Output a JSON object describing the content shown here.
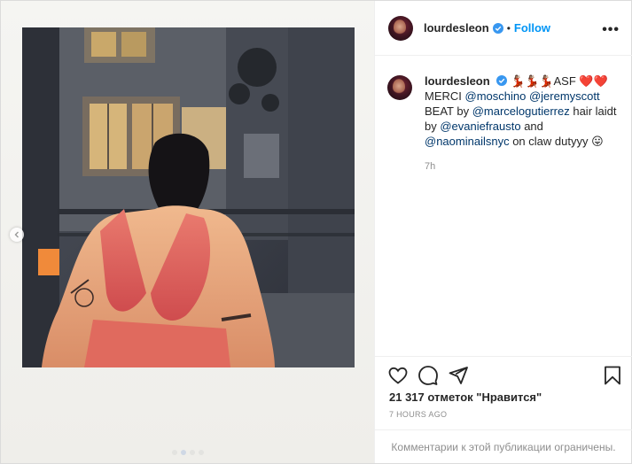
{
  "post": {
    "username": "lourdesleon",
    "separator": "•",
    "follow_label": "Follow",
    "more_label": "•••",
    "caption": {
      "emoji_line": "💃🏽💃🏽💃🏽ASF ❤️❤️",
      "p1": "MERCI ",
      "m1": "@moschino",
      "p2": " ",
      "m2": "@jeremyscott",
      "p3": " BEAT by ",
      "m3": "@marcelogutierrez",
      "p4": " hair laidt by ",
      "m4": "@evaniefrausto",
      "p5": " and ",
      "m5": "@naominailsnyc",
      "p6": " on claw dutyyy 😛"
    },
    "time_ago": "7h",
    "likes_text": "21 317 отметок \"Нравится\"",
    "date_text": "7 HOURS AGO",
    "comments_limited_text": "Комментарии к этой публикации ограничены."
  },
  "icons": {
    "verified": "verified-badge-icon",
    "heart": "heart-outline-icon",
    "comment": "comment-bubble-icon",
    "share": "paper-plane-icon",
    "save": "bookmark-icon",
    "prev": "chevron-left-icon"
  },
  "colors": {
    "accent": "#0095f6",
    "mention": "#00376b",
    "muted": "#8e8e8e",
    "verified": "#3897f0"
  },
  "carousel": {
    "count": 4,
    "active": 1
  }
}
